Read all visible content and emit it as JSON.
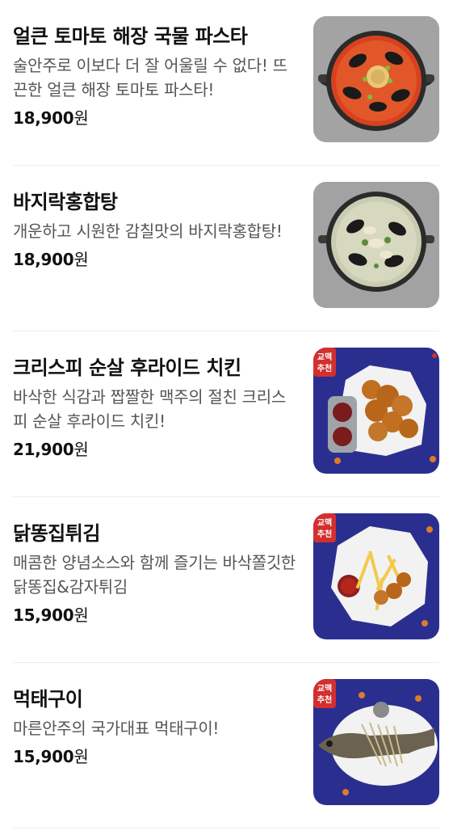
{
  "menu": {
    "items": [
      {
        "name": "얼큰 토마토 해장 국물 파스타",
        "desc": "술안주로 이보다 더 잘 어울릴 수 없다! 뜨끈한 얼큰 해장 토마토 파스타!",
        "price": "18,900",
        "currency": "원",
        "image": "tomato-pasta-pot-image"
      },
      {
        "name": "바지락홍합탕",
        "desc": "개운하고 시원한 감칠맛의 바지락홍합탕!",
        "price": "18,900",
        "currency": "원",
        "image": "clam-mussel-soup-image"
      },
      {
        "name": "크리스피 순살 후라이드 치킨",
        "desc": "바삭한 식감과 짭짤한 맥주의 절친 크리스피 순살 후라이드 치킨!",
        "price": "21,900",
        "currency": "원",
        "image": "fried-chicken-image",
        "badge": [
          "교맥",
          "추천"
        ]
      },
      {
        "name": "닭똥집튀김",
        "desc": "매콤한 양념소스와 함께 즐기는 바삭쫄깃한 닭똥집&감자튀김",
        "price": "15,900",
        "currency": "원",
        "image": "gizzard-fries-image",
        "badge": [
          "교맥",
          "추천"
        ]
      },
      {
        "name": "먹태구이",
        "desc": "마른안주의 국가대표 먹태구이!",
        "price": "15,900",
        "currency": "원",
        "image": "grilled-pollack-image",
        "badge": [
          "교맥",
          "추천"
        ]
      }
    ]
  },
  "colors": {
    "badge_red": "#d32f2f",
    "blue_bg": "#2a2f8f",
    "gray_bg": "#9a9a9a"
  }
}
